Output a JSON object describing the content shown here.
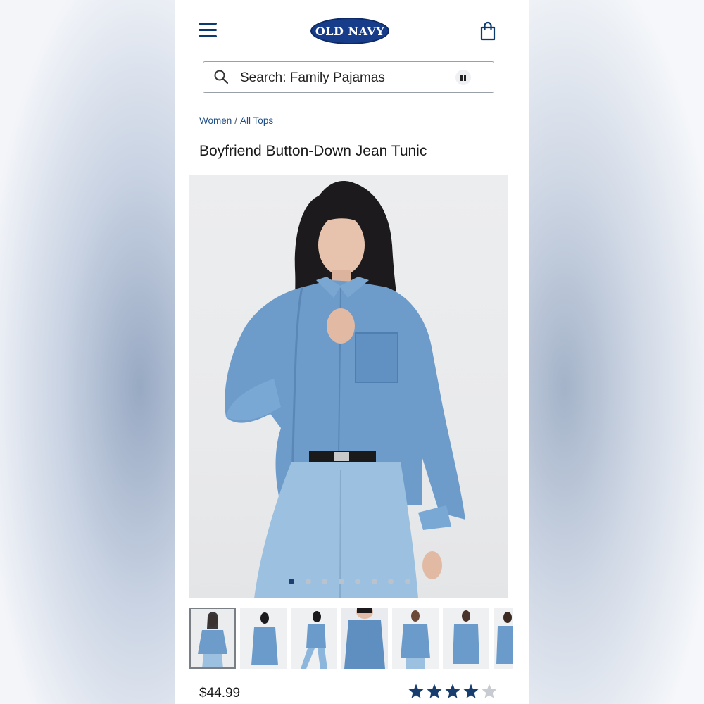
{
  "header": {
    "logo_text": "OLD NAVY",
    "menu_icon": "hamburger-menu-icon",
    "bag_icon": "shopping-bag-icon",
    "brand_color": "#173d8a"
  },
  "search": {
    "label": "Search: Family Pajamas",
    "search_icon": "search-icon",
    "pause_icon": "pause-icon"
  },
  "breadcrumb": {
    "items": [
      "Women",
      "All Tops"
    ],
    "separator": "/"
  },
  "product": {
    "title": "Boyfriend Button-Down Jean Tunic",
    "price": "$44.99",
    "rating": 4,
    "rating_max": 5,
    "star_color": "#173d6e",
    "empty_star_color": "#c8ccd2"
  },
  "gallery": {
    "image_count": 8,
    "active_index": 0,
    "thumbnails": 7,
    "selected_thumbnail": 0
  }
}
